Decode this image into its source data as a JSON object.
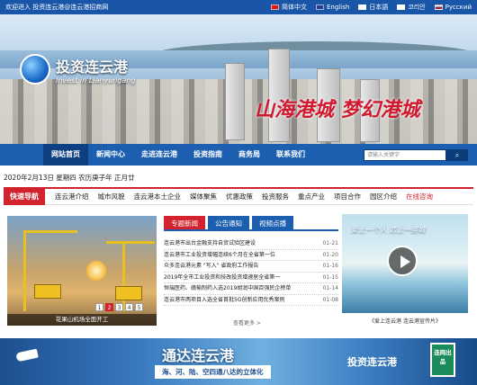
{
  "topbar": {
    "welcome": "欢迎进入 投资连云港@连云港招商网",
    "langs": [
      {
        "label": "简体中文",
        "color": "#d21c1c"
      },
      {
        "label": "English",
        "color": "#233f8f"
      },
      {
        "label": "日本語",
        "color": "#ffffff"
      },
      {
        "label": "코리안",
        "color": "#ffffff"
      },
      {
        "label": "Русский",
        "color": "#d21c1c"
      }
    ]
  },
  "header": {
    "logo_cn": "投资连云港",
    "logo_en": "Invest in Lianyungang",
    "slogan": "山海港城 梦幻港城"
  },
  "nav": {
    "items": [
      "网站首页",
      "新闻中心",
      "走进连云港",
      "投资指南",
      "商务局",
      "联系我们"
    ],
    "search_placeholder": "请输入关键字",
    "search_btn": "⌕"
  },
  "datebar": "2020年2月13日 星期四 农历庚子年 正月廿",
  "quick": {
    "title": "快速导航",
    "links": [
      "连云港介绍",
      "城市风貌",
      "连云港本土企业",
      "媒体聚焦",
      "优惠政策",
      "投资服务",
      "重点产业",
      "项目合作",
      "园区介绍",
      "在线咨询"
    ]
  },
  "photo": {
    "caption": "花果山机场全面开工",
    "pages": [
      "1",
      "2",
      "3",
      "4",
      "5"
    ]
  },
  "news": {
    "tabs": [
      "专题新闻",
      "公告通知",
      "视频点播"
    ],
    "items": [
      {
        "title": "连云港市出台金融支持自贸试验区建设",
        "date": "01-21"
      },
      {
        "title": "连云港市工业投资增幅连续6个月在全省第一位",
        "date": "01-20"
      },
      {
        "title": "众多连云港元素 \"写入\" 省政府工作报告",
        "date": "01-16"
      },
      {
        "title": "2019年全市工业投资和技改投资增速居全省第一",
        "date": "01-15"
      },
      {
        "title": "恒瑞医药、赣榆制药入选2019胡润中国百强民企榜单",
        "date": "01-14"
      },
      {
        "title": "连云港市两项目入选全省首批5G创新应用优秀案例",
        "date": "01-08"
      }
    ],
    "more": "查看更多 >"
  },
  "video": {
    "title": "爱上一个人 恋上一座城",
    "caption": "《爱上连云港 连云港宣传片》"
  },
  "banner": {
    "title": "通达连云港",
    "sub": "海、河、陆、空四通八达的立体化",
    "logo": "投资连云港",
    "badge": "连网出品"
  }
}
